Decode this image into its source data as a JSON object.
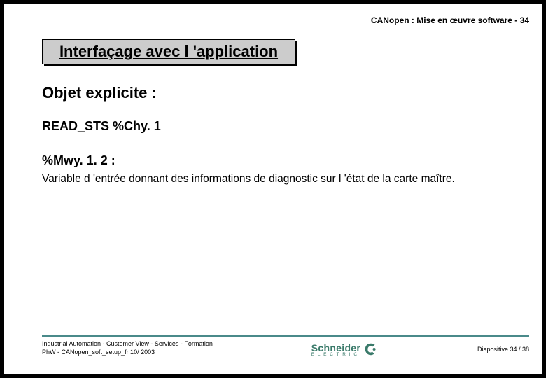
{
  "header": {
    "title_line": "CANopen : Mise en œuvre software -",
    "page_no": "34"
  },
  "title_box": "Interfaçage avec l 'application",
  "content": {
    "objet": "Objet explicite :",
    "read_sts": "READ_STS %Chy. 1",
    "mwy": "%Mwy. 1. 2 :",
    "body": "Variable d 'entrée donnant des informations de diagnostic sur l 'état de la carte maître."
  },
  "footer": {
    "line1": "Industrial Automation - Customer View - Services - Formation",
    "line2": "PhW - CANopen_soft_setup_fr  10/ 2003",
    "counter": "Diapositive 34 / 38"
  },
  "logo": {
    "brand": "Schneider",
    "sub": "E L E C T R I C"
  }
}
